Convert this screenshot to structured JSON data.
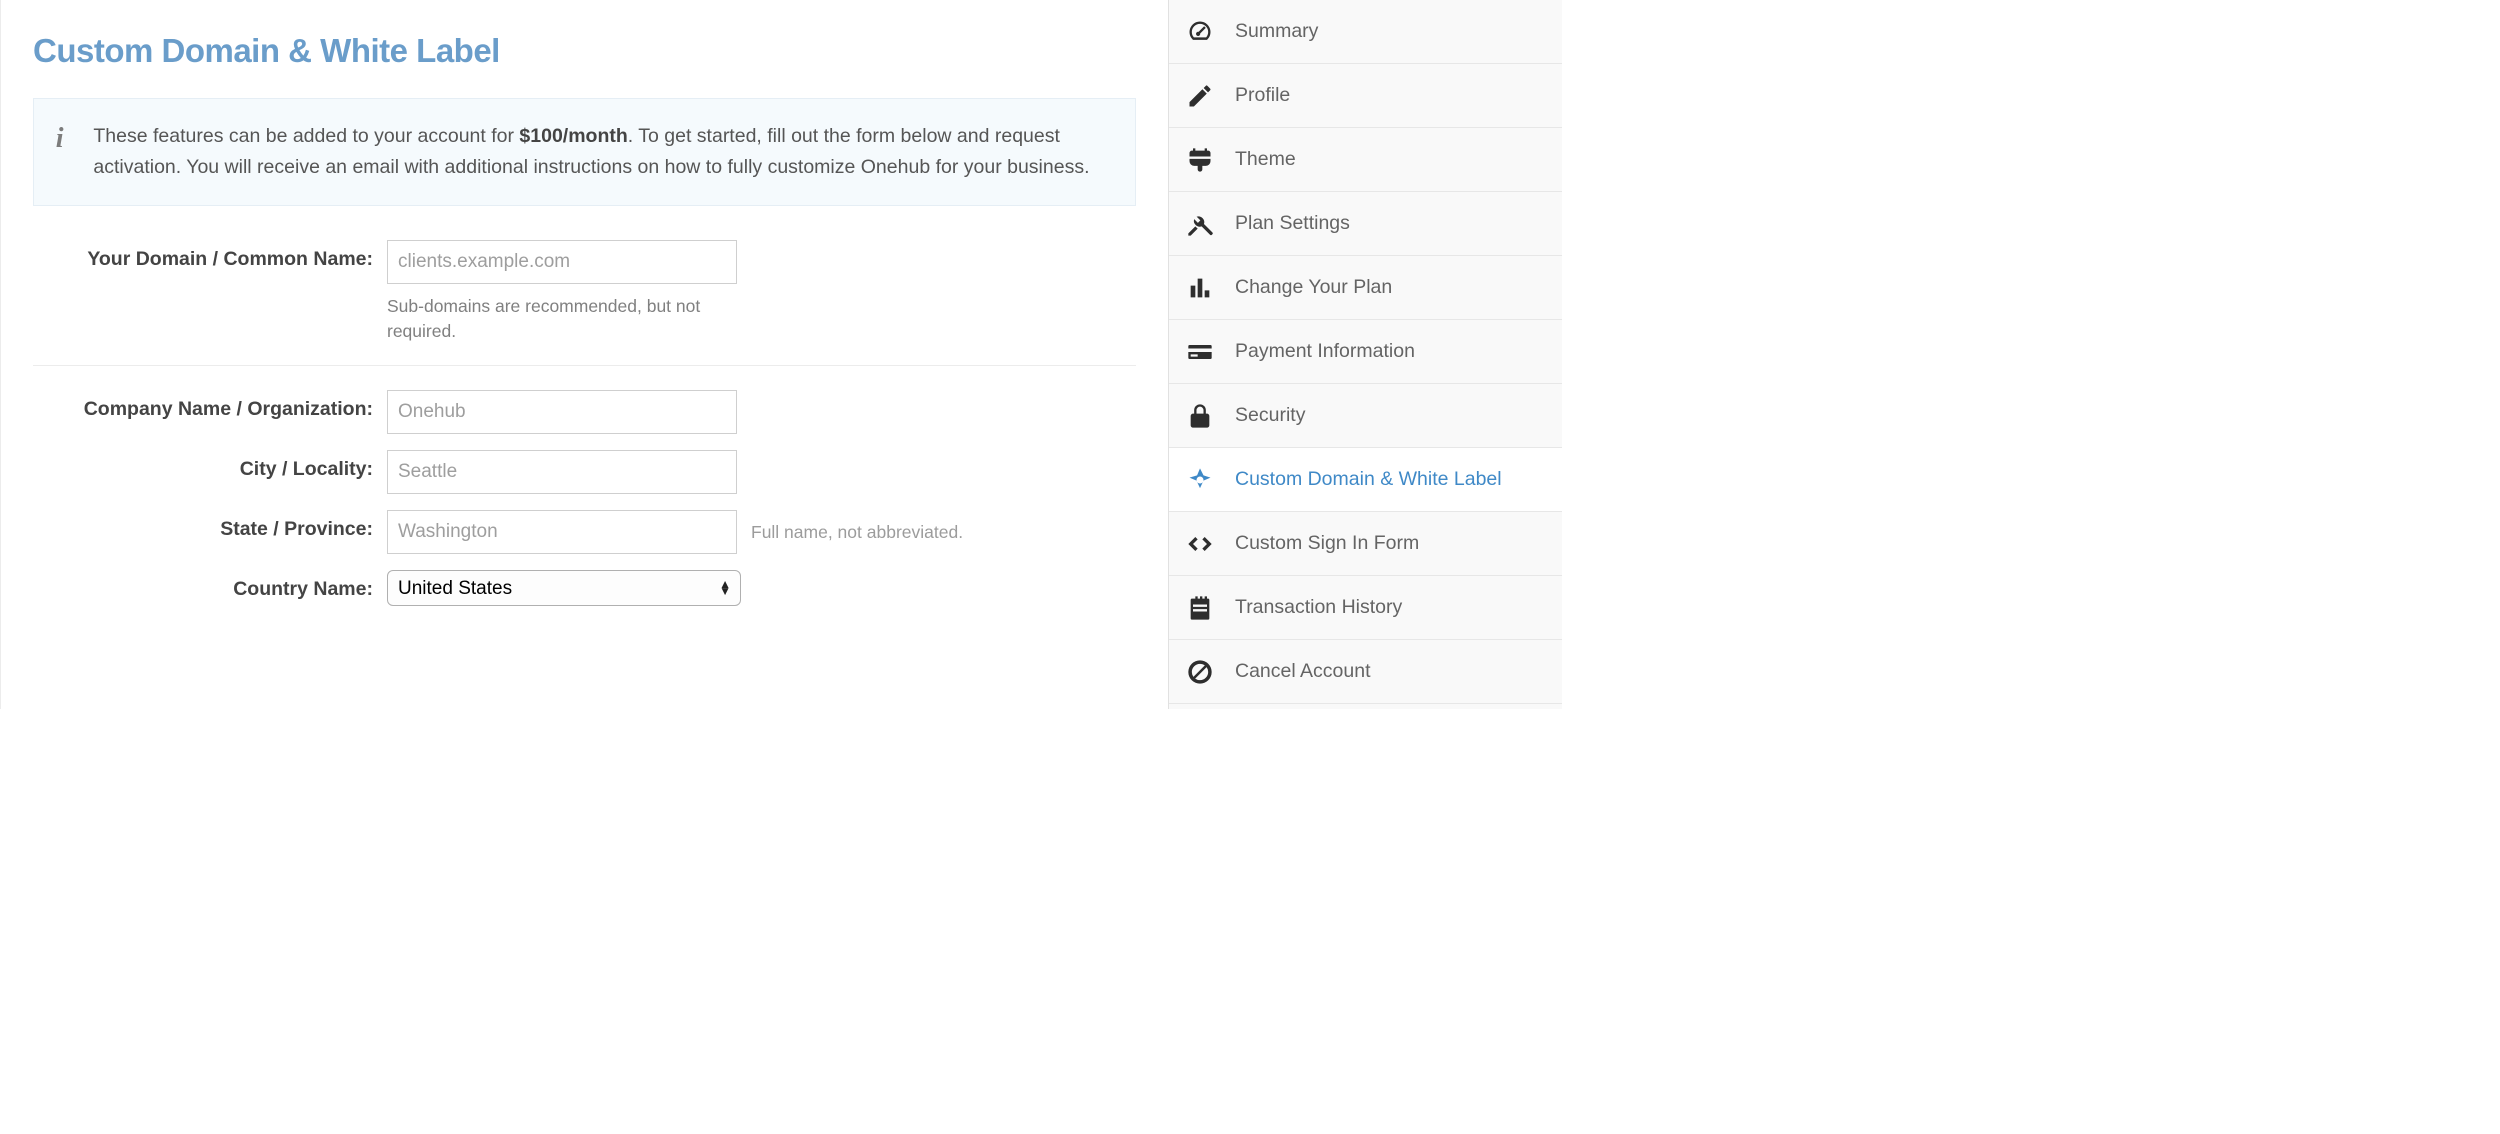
{
  "page": {
    "title": "Custom Domain & White Label"
  },
  "info": {
    "prefix": "These features can be added to your account for ",
    "price": "$100/month",
    "suffix": ". To get started, fill out the form below and request activation. You will receive an email with additional instructions on how to fully customize Onehub for your business."
  },
  "form": {
    "domain": {
      "label": "Your Domain / Common Name:",
      "value": "",
      "placeholder": "clients.example.com",
      "help": "Sub-domains are recommended, but not required."
    },
    "company": {
      "label": "Company Name / Organization:",
      "value": "",
      "placeholder": "Onehub"
    },
    "city": {
      "label": "City / Locality:",
      "value": "",
      "placeholder": "Seattle"
    },
    "state": {
      "label": "State / Province:",
      "value": "",
      "placeholder": "Washington",
      "help_inline": "Full name, not abbreviated."
    },
    "country": {
      "label": "Country Name:",
      "selected": "United States"
    }
  },
  "sidebar": {
    "items": [
      {
        "label": "Summary",
        "icon": "gauge-icon",
        "active": false
      },
      {
        "label": "Profile",
        "icon": "pencil-icon",
        "active": false
      },
      {
        "label": "Theme",
        "icon": "paint-icon",
        "active": false
      },
      {
        "label": "Plan Settings",
        "icon": "tools-icon",
        "active": false
      },
      {
        "label": "Change Your Plan",
        "icon": "bars-icon",
        "active": false
      },
      {
        "label": "Payment Information",
        "icon": "card-icon",
        "active": false
      },
      {
        "label": "Security",
        "icon": "lock-icon",
        "active": false
      },
      {
        "label": "Custom Domain & White Label",
        "icon": "compass-icon",
        "active": true
      },
      {
        "label": "Custom Sign In Form",
        "icon": "code-icon",
        "active": false
      },
      {
        "label": "Transaction History",
        "icon": "notepad-icon",
        "active": false
      },
      {
        "label": "Cancel Account",
        "icon": "cancel-icon",
        "active": false
      }
    ]
  }
}
